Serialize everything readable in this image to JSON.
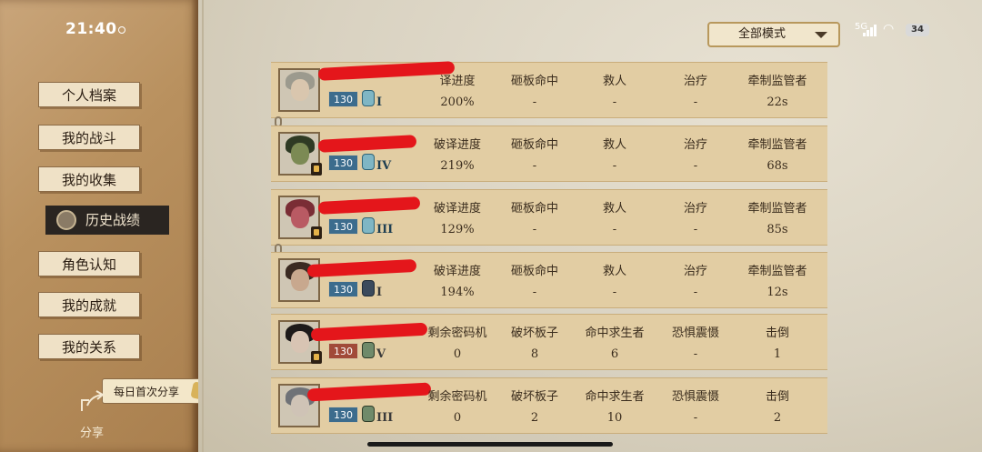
{
  "status_bar": {
    "time": "21:40",
    "network": "5G",
    "battery": "34"
  },
  "sidebar": {
    "items": [
      {
        "label": "个人档案"
      },
      {
        "label": "我的战斗"
      },
      {
        "label": "我的收集"
      },
      {
        "label": "历史战绩",
        "active": true
      },
      {
        "label": "角色认知"
      },
      {
        "label": "我的成就"
      },
      {
        "label": "我的关系"
      }
    ],
    "share_banner": "每日首次分享",
    "share_label": "分享"
  },
  "mode_select": {
    "value": "全部模式"
  },
  "records": [
    {
      "level": "130",
      "level_color": "#3c6c8d",
      "rank": "I",
      "role": "survivor",
      "headers": [
        "破译进度",
        "砸板命中",
        "救人",
        "治疗",
        "牵制监管者"
      ],
      "values": [
        "200%",
        "-",
        "-",
        "-",
        "22s"
      ],
      "partial_header": "译进度"
    },
    {
      "level": "130",
      "level_color": "#3c6c8d",
      "rank": "IV",
      "role": "survivor",
      "headers": [
        "破译进度",
        "砸板命中",
        "救人",
        "治疗",
        "牵制监管者"
      ],
      "values": [
        "219%",
        "-",
        "-",
        "-",
        "68s"
      ]
    },
    {
      "level": "130",
      "level_color": "#3c6c8d",
      "rank": "III",
      "role": "survivor",
      "headers": [
        "破译进度",
        "砸板命中",
        "救人",
        "治疗",
        "牵制监管者"
      ],
      "values": [
        "129%",
        "-",
        "-",
        "-",
        "85s"
      ]
    },
    {
      "level": "130",
      "level_color": "#3c6c8d",
      "rank": "I",
      "role": "survivor",
      "headers": [
        "破译进度",
        "砸板命中",
        "救人",
        "治疗",
        "牵制监管者"
      ],
      "values": [
        "194%",
        "-",
        "-",
        "-",
        "12s"
      ]
    },
    {
      "level": "130",
      "level_color": "#a14a39",
      "rank": "V",
      "role": "hunter",
      "headers": [
        "剩余密码机",
        "破坏板子",
        "命中求生者",
        "恐惧震慑",
        "击倒"
      ],
      "values": [
        "0",
        "8",
        "6",
        "-",
        "1"
      ]
    },
    {
      "level": "130",
      "level_color": "#3c6c8d",
      "rank": "III",
      "role": "hunter",
      "headers": [
        "剩余密码机",
        "破坏板子",
        "命中求生者",
        "恐惧震慑",
        "击倒"
      ],
      "values": [
        "0",
        "2",
        "10",
        "-",
        "2"
      ]
    }
  ]
}
